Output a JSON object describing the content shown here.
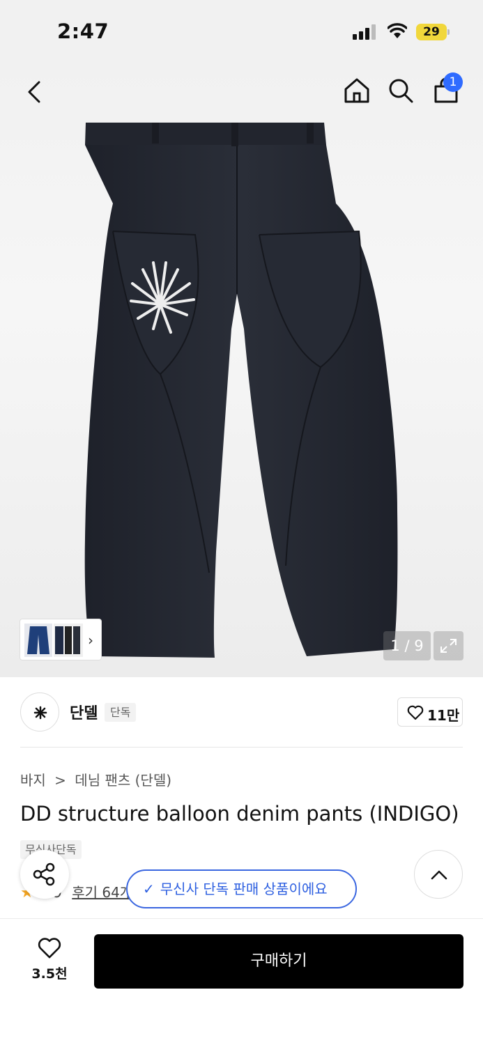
{
  "status_bar": {
    "time": "2:47",
    "battery": "29"
  },
  "nav": {
    "cart_badge": "1"
  },
  "gallery": {
    "counter": "1 / 9"
  },
  "brand": {
    "name": "단델",
    "tag": "단독",
    "like_count": "11만"
  },
  "breadcrumb": {
    "category": "바지",
    "separator": ">",
    "subcategory": "데님 팬츠 (단델)"
  },
  "product": {
    "title": "DD structure balloon denim pants (INDIGO)",
    "exclusive_tag": "무신사단독",
    "rating_score": "4.9",
    "reviews_label": "후기 64개"
  },
  "toast": {
    "message": "무신사 단독 판매 상품이에요"
  },
  "bottom": {
    "wish_count": "3.5천",
    "buy_label": "구매하기"
  },
  "colors": {
    "accent_blue": "#2f6bff",
    "denim": "#23262f",
    "buy_bg": "#000000"
  }
}
